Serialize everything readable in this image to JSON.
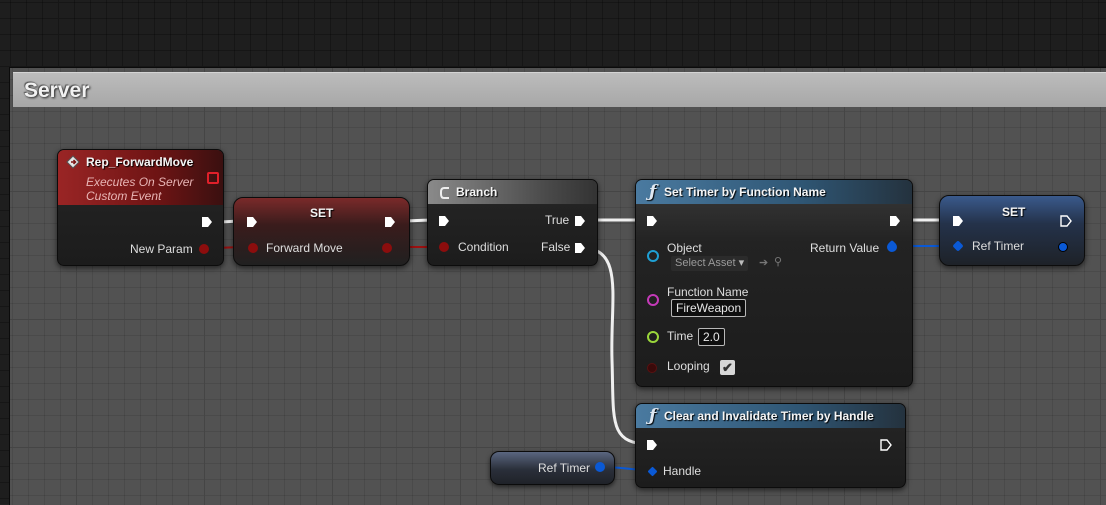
{
  "comment": {
    "title": "Server"
  },
  "nodes": {
    "event": {
      "title": "Rep_ForwardMove",
      "subtitle1": "Executes On Server",
      "subtitle2": "Custom Event",
      "pin_new_param": "New Param"
    },
    "set1": {
      "title": "SET",
      "pin_forward_move": "Forward Move"
    },
    "branch": {
      "title": "Branch",
      "pin_condition": "Condition",
      "pin_true": "True",
      "pin_false": "False"
    },
    "timer": {
      "title": "Set Timer by Function Name",
      "pin_object": "Object",
      "object_value": "Select Asset",
      "pin_function_name": "Function Name",
      "function_name_value": "FireWeapon",
      "pin_time": "Time",
      "time_value": "2.0",
      "pin_looping": "Looping",
      "looping_checked": "✔",
      "pin_return_value": "Return Value"
    },
    "set2": {
      "title": "SET",
      "pin_ref_timer": "Ref Timer"
    },
    "clear": {
      "title": "Clear and Invalidate Timer by Handle",
      "pin_handle": "Handle"
    },
    "ref_timer_get": {
      "label": "Ref Timer"
    }
  },
  "colors": {
    "exec": "#ffffff",
    "bool": "#8c0d0d",
    "object": "#1fa0d4",
    "name": "#c43ab8",
    "float": "#9ad63b",
    "struct": "#0a59d6",
    "event_header": "#8a1c1c",
    "function_header": "#3b6a8c"
  },
  "icons": {
    "event": "event-diamond-icon",
    "branch": "branch-icon",
    "function": "function-f-icon",
    "arrow": "arrow-left-icon",
    "browse": "magnifier-icon",
    "delegate": "delegate-square-icon"
  }
}
